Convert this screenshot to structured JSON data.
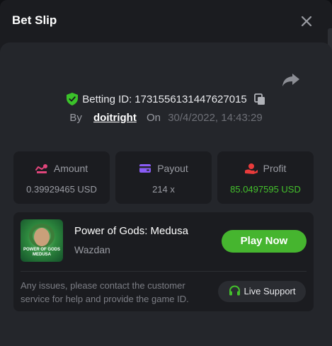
{
  "header": {
    "title": "Bet Slip"
  },
  "bet": {
    "id_label": "Betting ID:",
    "id_value": "1731556131447627015",
    "by_label": "By",
    "user": "doitright",
    "on_label": "On",
    "datetime": "30/4/2022, 14:43:29"
  },
  "stats": {
    "amount": {
      "label": "Amount",
      "value": "0.39929465 USD"
    },
    "payout": {
      "label": "Payout",
      "value": "214 x"
    },
    "profit": {
      "label": "Profit",
      "value": "85.0497595 USD"
    }
  },
  "game": {
    "thumb_text": "POWER OF GODS MEDUSA",
    "name": "Power of Gods: Medusa",
    "provider": "Wazdan",
    "play_label": "Play Now"
  },
  "support": {
    "text": "Any issues, please contact the customer service for help and provide the game ID.",
    "button_label": "Live Support"
  },
  "colors": {
    "accent_green": "#46b52f",
    "profit_green": "#44c02c",
    "amount_icon": "#e0457b",
    "payout_icon": "#8a5cf6",
    "profit_icon": "#e83b3b"
  },
  "icons": [
    "close-icon",
    "share-icon",
    "shield-check-icon",
    "copy-icon",
    "coins-icon",
    "wallet-icon",
    "hand-coin-icon",
    "headset-icon"
  ]
}
